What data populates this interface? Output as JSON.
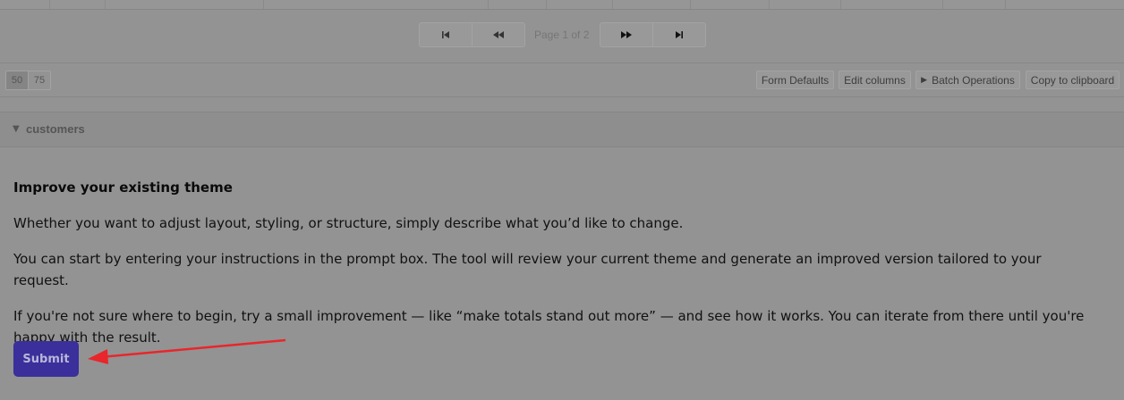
{
  "pager": {
    "first_icon": "first-page-icon",
    "prev_icon": "previous-page-icon",
    "page_info": "Page 1 of 2",
    "next_icon": "next-page-icon",
    "last_icon": "last-page-icon"
  },
  "toolbar": {
    "per_page_options": [
      "50",
      "75"
    ],
    "per_page_selected": "50",
    "form_defaults_label": "Form Defaults",
    "edit_columns_label": "Edit columns",
    "batch_operations_label": "Batch Operations",
    "copy_clipboard_label": "Copy to clipboard"
  },
  "section": {
    "title": "customers"
  },
  "content": {
    "heading": "Improve your existing theme",
    "paragraph1": "Whether you want to adjust layout, styling, or structure, simply describe what you’d like to change.",
    "paragraph2": "You can start by entering your instructions in the prompt box. The tool will review your current theme and generate an improved version tailored to your request.",
    "paragraph3": "If you're not sure where to begin, try a small improvement — like “make totals stand out more” — and see how it works. You can iterate from there until you're happy with the result.",
    "submit_label": "Submit"
  },
  "colors": {
    "overlay_bg": "#939393",
    "submit_bg": "#3a2f9b",
    "annotation_arrow": "#e8262b"
  }
}
